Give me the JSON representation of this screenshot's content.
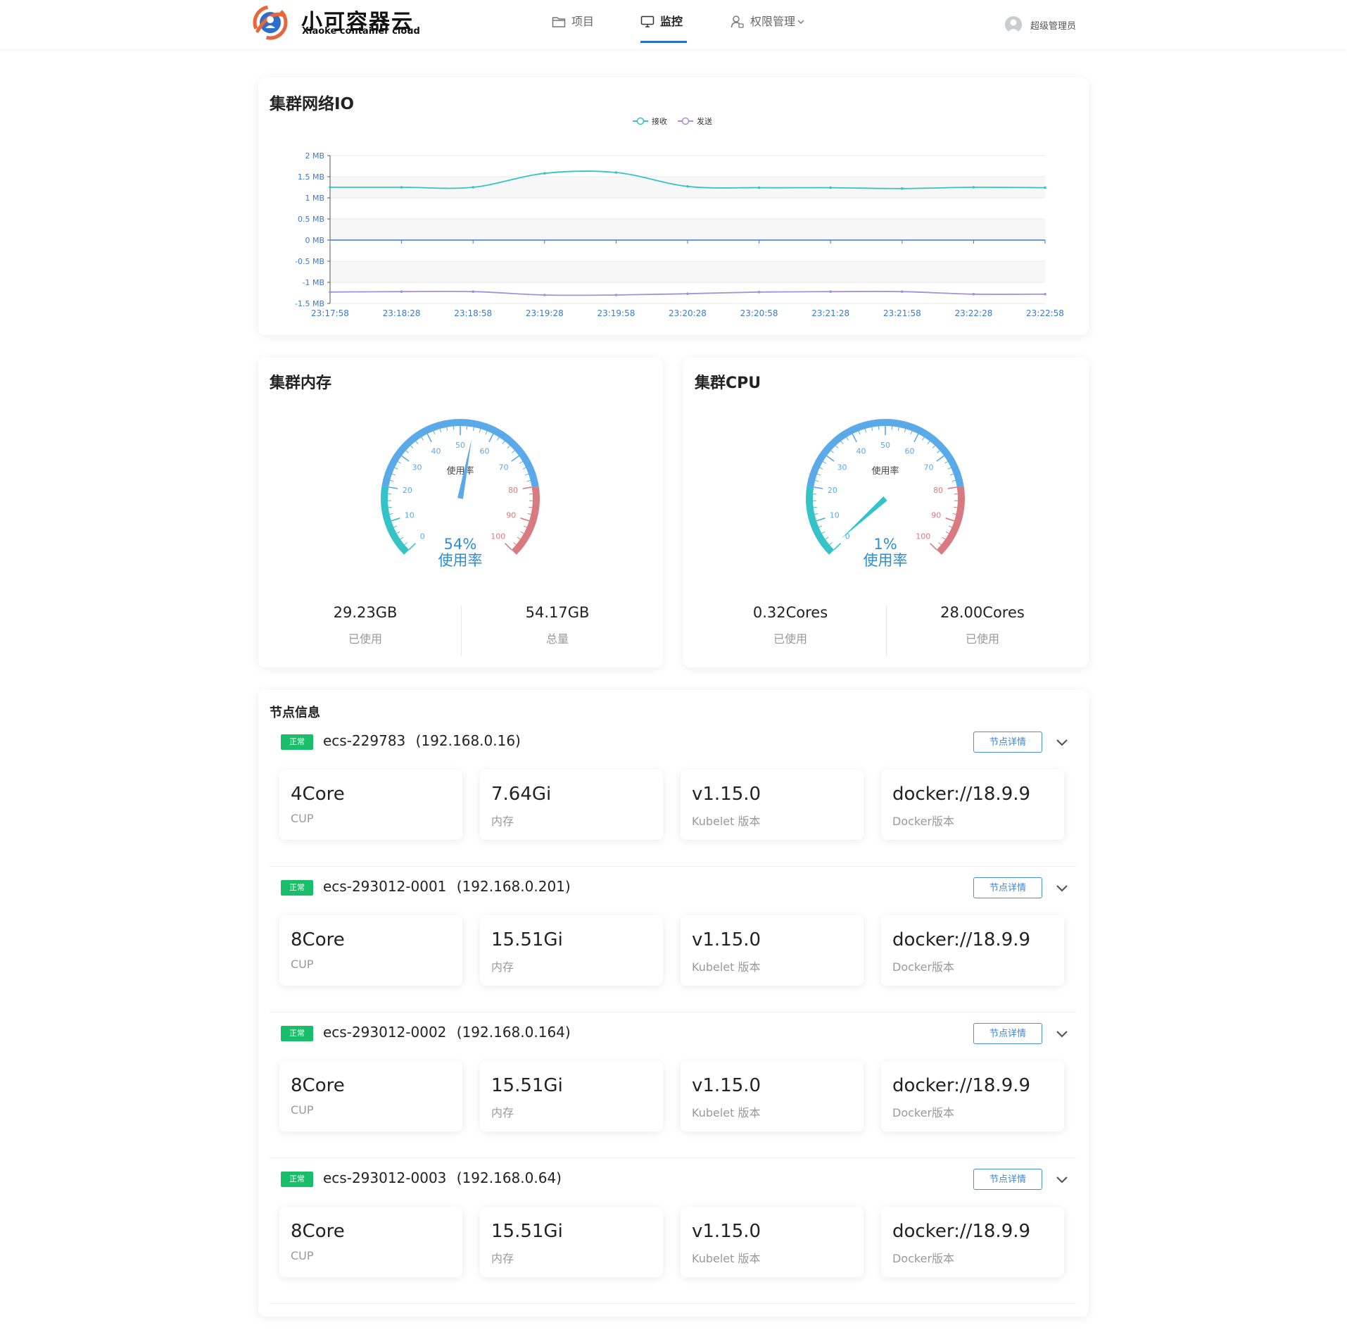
{
  "header": {
    "brand_title": "小可容器云",
    "brand_subtitle": "Xiaoke container cloud",
    "nav": [
      {
        "label": "项目",
        "icon": "folder-icon",
        "active": false
      },
      {
        "label": "监控",
        "icon": "monitor-icon",
        "active": true
      },
      {
        "label": "权限管理",
        "icon": "user-lock-icon",
        "active": false
      }
    ],
    "user_name": "超级管理员",
    "accent_color": "#2a6fd1"
  },
  "network_io": {
    "title": "集群网络IO",
    "legend": [
      {
        "name": "接收",
        "color": "#36c3c8"
      },
      {
        "name": "发送",
        "color": "#a890d8"
      }
    ]
  },
  "memory": {
    "title": "集群内存",
    "gauge": {
      "percent_text": "54%",
      "caption": "使用率",
      "inner_label": "使用率",
      "value": 54
    },
    "used_value": "29.23GB",
    "used_label": "已使用",
    "total_value": "54.17GB",
    "total_label": "总量"
  },
  "cpu": {
    "title": "集群CPU",
    "gauge": {
      "percent_text": "1%",
      "caption": "使用率",
      "inner_label": "使用率",
      "value": 1
    },
    "used_value": "0.32Cores",
    "used_label": "已使用",
    "total_value": "28.00Cores",
    "total_label": "已使用"
  },
  "nodes": {
    "title": "节点信息",
    "detail_label": "节点详情",
    "status_color": "#19be6b",
    "items": [
      {
        "status": "正常",
        "name": "ecs-229783",
        "ip": "(192.168.0.16)",
        "metrics": [
          {
            "value": "4Core",
            "label": "CUP"
          },
          {
            "value": "7.64Gi",
            "label": "内存"
          },
          {
            "value": "v1.15.0",
            "label": "Kubelet 版本"
          },
          {
            "value": "docker://18.9.9",
            "label": "Docker版本"
          }
        ]
      },
      {
        "status": "正常",
        "name": "ecs-293012-0001",
        "ip": "(192.168.0.201)",
        "metrics": [
          {
            "value": "8Core",
            "label": "CUP"
          },
          {
            "value": "15.51Gi",
            "label": "内存"
          },
          {
            "value": "v1.15.0",
            "label": "Kubelet 版本"
          },
          {
            "value": "docker://18.9.9",
            "label": "Docker版本"
          }
        ]
      },
      {
        "status": "正常",
        "name": "ecs-293012-0002",
        "ip": "(192.168.0.164)",
        "metrics": [
          {
            "value": "8Core",
            "label": "CUP"
          },
          {
            "value": "15.51Gi",
            "label": "内存"
          },
          {
            "value": "v1.15.0",
            "label": "Kubelet 版本"
          },
          {
            "value": "docker://18.9.9",
            "label": "Docker版本"
          }
        ]
      },
      {
        "status": "正常",
        "name": "ecs-293012-0003",
        "ip": "(192.168.0.64)",
        "metrics": [
          {
            "value": "8Core",
            "label": "CUP"
          },
          {
            "value": "15.51Gi",
            "label": "内存"
          },
          {
            "value": "v1.15.0",
            "label": "Kubelet 版本"
          },
          {
            "value": "docker://18.9.9",
            "label": "Docker版本"
          }
        ]
      }
    ]
  },
  "chart_data": [
    {
      "type": "line",
      "title": "集群网络IO",
      "x": [
        "23:17:58",
        "23:18:28",
        "23:18:58",
        "23:19:28",
        "23:19:58",
        "23:20:28",
        "23:20:58",
        "23:21:28",
        "23:21:58",
        "23:22:28",
        "23:22:58"
      ],
      "series": [
        {
          "name": "接收",
          "color": "#36c3c8",
          "values": [
            1.25,
            1.25,
            1.25,
            1.58,
            1.6,
            1.27,
            1.24,
            1.24,
            1.22,
            1.25,
            1.24
          ]
        },
        {
          "name": "发送",
          "color": "#a890d8",
          "values": [
            -1.23,
            -1.22,
            -1.22,
            -1.3,
            -1.3,
            -1.27,
            -1.23,
            -1.22,
            -1.22,
            -1.28,
            -1.28
          ]
        }
      ],
      "ytick_labels": [
        "2 MB",
        "1.5 MB",
        "1 MB",
        "0.5 MB",
        "0 MB",
        "-0.5 MB",
        "-1 MB",
        "-1.5 MB"
      ],
      "ylim": [
        -1.5,
        2
      ],
      "yunit": "MB",
      "grid": true,
      "legend_position": "top-center"
    },
    {
      "type": "gauge",
      "title": "集群内存",
      "value": 54,
      "min": 0,
      "max": 100,
      "tick_labels": [
        "0",
        "10",
        "20",
        "30",
        "40",
        "50",
        "60",
        "70",
        "80",
        "90",
        "100"
      ],
      "colors": [
        "#36c3c8",
        "#5aa9e8",
        "#d97a80"
      ]
    },
    {
      "type": "gauge",
      "title": "集群CPU",
      "value": 1,
      "min": 0,
      "max": 100,
      "tick_labels": [
        "0",
        "10",
        "20",
        "30",
        "40",
        "50",
        "60",
        "70",
        "80",
        "90",
        "100"
      ],
      "colors": [
        "#36c3c8",
        "#5aa9e8",
        "#d97a80"
      ]
    }
  ]
}
